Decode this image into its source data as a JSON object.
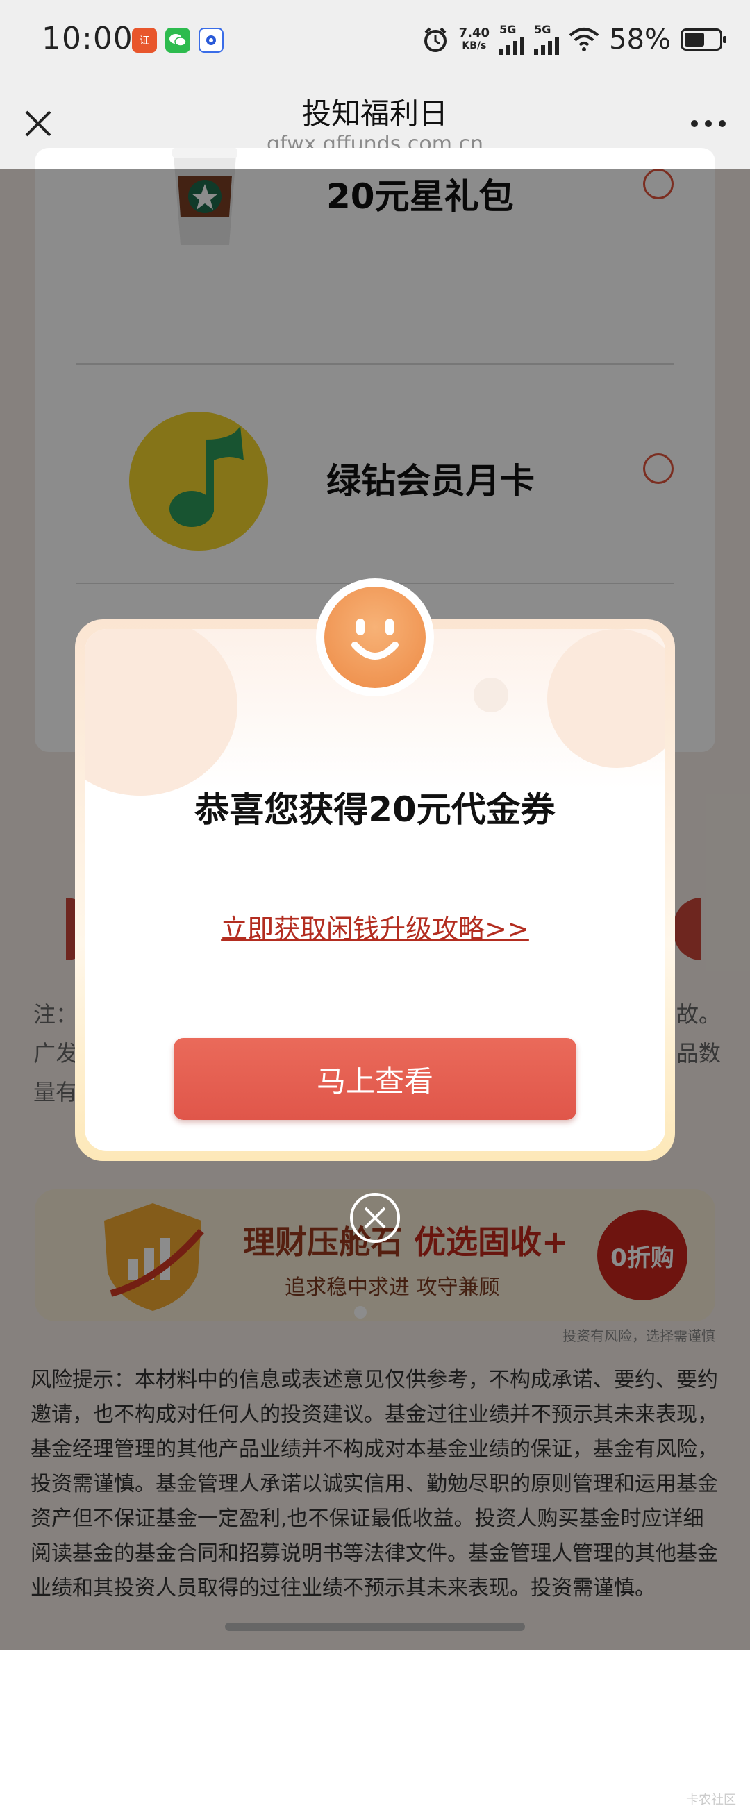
{
  "status_bar": {
    "time": "10:00",
    "net_speed": "7.40",
    "net_unit": "KB/s",
    "signal1": "5G",
    "signal2": "5G",
    "battery": "58%",
    "battery_level": 0.58
  },
  "nav": {
    "title": "投知福利日",
    "url": "gfwx.gffunds.com.cn"
  },
  "prizes": [
    {
      "name": "20元星礼包",
      "icon": "coffee-cup-icon"
    },
    {
      "name": "绿钻会员月卡",
      "icon": "music-note-icon"
    }
  ],
  "note": {
    "left_line1": "注：",
    "left_line2": "广发",
    "left_line3": "量有",
    "right_line1": "故。",
    "right_line2": "品数"
  },
  "banner": {
    "title_a": "理财压舱石",
    "title_b": "优选固收+",
    "subtitle": "追求稳中求进 攻守兼顾",
    "discount": "0折购",
    "risk_small": "投资有风险，选择需谨慎"
  },
  "risk_text": "风险提示：本材料中的信息或表述意见仅供参考，不构成承诺、要约、要约邀请，也不构成对任何人的投资建议。基金过往业绩并不预示其未来表现，基金经理管理的其他产品业绩并不构成对本基金业绩的保证，基金有风险，投资需谨慎。基金管理人承诺以诚实信用、勤勉尽职的原则管理和运用基金资产但不保证基金一定盈利,也不保证最低收益。投资人购买基金时应详细阅读基金的基金合同和招募说明书等法律文件。基金管理人管理的其他基金业绩和其投资人员取得的过往业绩不预示其未来表现。投资需谨慎。",
  "dialog": {
    "title": "恭喜您获得20元代金券",
    "link": "立即获取闲钱升级攻略>>",
    "button": "马上查看"
  },
  "watermark": "卡农社区",
  "colors": {
    "accent_red": "#e0564a",
    "link_red": "#b32d20",
    "smiley_orange": "#ed8a45"
  }
}
